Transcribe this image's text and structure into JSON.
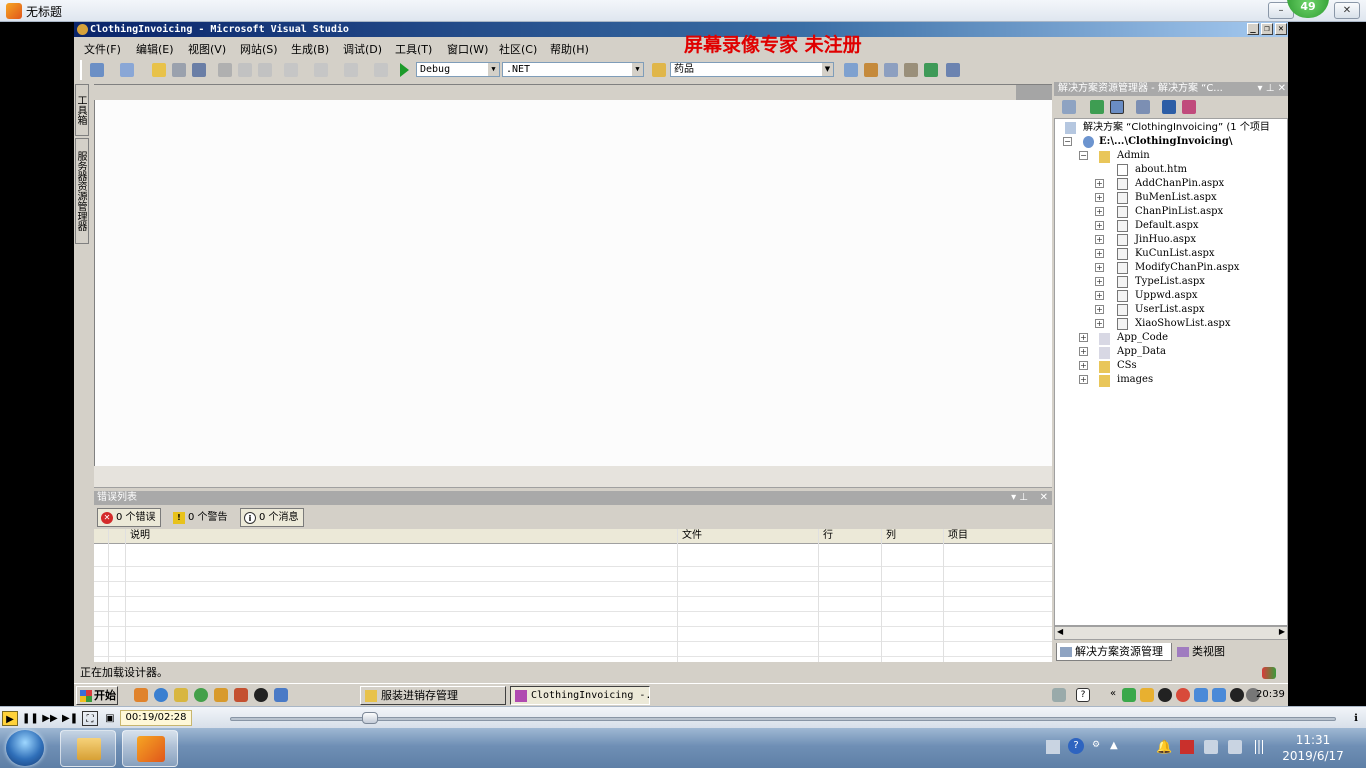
{
  "player": {
    "title": "无标题",
    "badge": "49",
    "time": "00:19/02:28",
    "seek_fraction": 0.127
  },
  "vs": {
    "title": "ClothingInvoicing - Microsoft Visual Studio",
    "watermark": "屏幕录像专家  未注册",
    "menu": [
      "文件(F)",
      "编辑(E)",
      "视图(V)",
      "网站(S)",
      "生成(B)",
      "调试(D)",
      "工具(T)",
      "窗口(W)",
      "社区(C)",
      "帮助(H)"
    ],
    "toolbar": {
      "config": "Debug",
      "platform": ".NET",
      "find": "药品"
    },
    "left_tabs": [
      "工具箱",
      "服务器资源管理器"
    ],
    "status": "正在加载设计器。"
  },
  "error_list": {
    "title": "错误列表",
    "errors": "0 个错误",
    "warnings": "0 个警告",
    "messages": "0 个消息",
    "columns": [
      "说明",
      "文件",
      "行",
      "列",
      "项目"
    ]
  },
  "solution_explorer": {
    "title": "解决方案资源管理器 - 解决方案 “C...",
    "solution": "解决方案 “ClothingInvoicing” (1 个项目",
    "project": "E:\\...\\ClothingInvoicing\\",
    "admin_folder": "Admin",
    "admin_files": [
      "about.htm",
      "AddChanPin.aspx",
      "BuMenList.aspx",
      "ChanPinList.aspx",
      "Default.aspx",
      "JinHuo.aspx",
      "KuCunList.aspx",
      "ModifyChanPin.aspx",
      "TypeList.aspx",
      "Uppwd.aspx",
      "UserList.aspx",
      "XiaoShowList.aspx"
    ],
    "folders": [
      "App_Code",
      "App_Data",
      "CSs",
      "images"
    ],
    "tabs": [
      "解决方案资源管理器",
      "类视图"
    ]
  },
  "xp_taskbar": {
    "start": "开始",
    "tasks": [
      "服装进销存管理",
      "ClothingInvoicing -..."
    ],
    "clock": "20:39"
  },
  "win7": {
    "time": "11:31",
    "date": "2019/6/17"
  }
}
